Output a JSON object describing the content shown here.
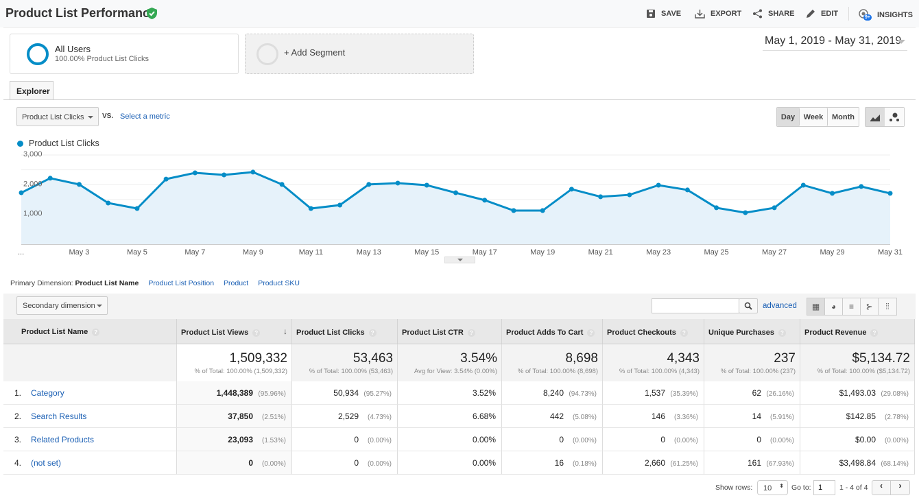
{
  "header": {
    "title": "Product List Performance",
    "actions": [
      {
        "label": "SAVE",
        "icon": "save-icon"
      },
      {
        "label": "EXPORT",
        "icon": "export-icon"
      },
      {
        "label": "SHARE",
        "icon": "share-icon"
      },
      {
        "label": "EDIT",
        "icon": "edit-icon"
      },
      {
        "label": "INSIGHTS",
        "icon": "insights-icon",
        "badge": "9+"
      }
    ]
  },
  "segments": {
    "active_name": "All Users",
    "active_sub": "100.00% Product List Clicks",
    "add_label": "+ Add Segment"
  },
  "date_range": "May 1, 2019 - May 31, 2019",
  "tab": "Explorer",
  "metric_select": "Product List Clicks",
  "vs": "VS.",
  "select_metric": "Select a metric",
  "granularity": {
    "options": [
      "Day",
      "Week",
      "Month"
    ],
    "selected": "Day"
  },
  "chart_data": {
    "type": "area",
    "legend": "Product List Clicks",
    "color": "#058dc7",
    "yticks": [
      "3,000",
      "2,000",
      "1,000"
    ],
    "ylim": [
      0,
      3000
    ],
    "grid": true,
    "xticks": [
      "...",
      "May 3",
      "May 5",
      "May 7",
      "May 9",
      "May 11",
      "May 13",
      "May 15",
      "May 17",
      "May 19",
      "May 21",
      "May 23",
      "May 25",
      "May 27",
      "May 29",
      "May 31"
    ],
    "x": [
      "May 1",
      "May 2",
      "May 3",
      "May 4",
      "May 5",
      "May 6",
      "May 7",
      "May 8",
      "May 9",
      "May 10",
      "May 11",
      "May 12",
      "May 13",
      "May 14",
      "May 15",
      "May 16",
      "May 17",
      "May 18",
      "May 19",
      "May 20",
      "May 21",
      "May 22",
      "May 23",
      "May 24",
      "May 25",
      "May 26",
      "May 27",
      "May 28",
      "May 29",
      "May 30",
      "May 31"
    ],
    "values": [
      1730,
      2220,
      2010,
      1385,
      1200,
      2190,
      2400,
      2330,
      2425,
      2010,
      1200,
      1315,
      2010,
      2055,
      1985,
      1730,
      1480,
      1130,
      1130,
      1850,
      1595,
      1660,
      1985,
      1825,
      1225,
      1060,
      1225,
      1985,
      1710,
      1940,
      1710
    ]
  },
  "primary_dimension": {
    "label": "Primary Dimension:",
    "selected": "Product List Name",
    "others": [
      "Product List Position",
      "Product",
      "Product SKU"
    ]
  },
  "secondary_dimension": "Secondary dimension",
  "advanced": "advanced",
  "table": {
    "columns": [
      "Product List Name",
      "Product List Views",
      "Product List Clicks",
      "Product List CTR",
      "Product Adds To Cart",
      "Product Checkouts",
      "Unique Purchases",
      "Product Revenue"
    ],
    "totals": [
      {
        "v": "1,509,332",
        "s": "% of Total: 100.00% (1,509,332)"
      },
      {
        "v": "53,463",
        "s": "% of Total: 100.00% (53,463)"
      },
      {
        "v": "3.54%",
        "s": "Avg for View: 3.54% (0.00%)"
      },
      {
        "v": "8,698",
        "s": "% of Total: 100.00% (8,698)"
      },
      {
        "v": "4,343",
        "s": "% of Total: 100.00% (4,343)"
      },
      {
        "v": "237",
        "s": "% of Total: 100.00% (237)"
      },
      {
        "v": "$5,134.72",
        "s": "% of Total: 100.00% ($5,134.72)"
      }
    ],
    "rows": [
      {
        "n": "1.",
        "name": "Category",
        "c": [
          [
            "1,448,389",
            "(95.96%)"
          ],
          [
            "50,934",
            "(95.27%)"
          ],
          [
            "3.52%",
            ""
          ],
          [
            "8,240",
            "(94.73%)"
          ],
          [
            "1,537",
            "(35.39%)"
          ],
          [
            "62",
            "(26.16%)"
          ],
          [
            "$1,493.03",
            "(29.08%)"
          ]
        ]
      },
      {
        "n": "2.",
        "name": "Search Results",
        "c": [
          [
            "37,850",
            "(2.51%)"
          ],
          [
            "2,529",
            "(4.73%)"
          ],
          [
            "6.68%",
            ""
          ],
          [
            "442",
            "(5.08%)"
          ],
          [
            "146",
            "(3.36%)"
          ],
          [
            "14",
            "(5.91%)"
          ],
          [
            "$142.85",
            "(2.78%)"
          ]
        ]
      },
      {
        "n": "3.",
        "name": "Related Products",
        "c": [
          [
            "23,093",
            "(1.53%)"
          ],
          [
            "0",
            "(0.00%)"
          ],
          [
            "0.00%",
            ""
          ],
          [
            "0",
            "(0.00%)"
          ],
          [
            "0",
            "(0.00%)"
          ],
          [
            "0",
            "(0.00%)"
          ],
          [
            "$0.00",
            "(0.00%)"
          ]
        ]
      },
      {
        "n": "4.",
        "name": "(not set)",
        "c": [
          [
            "0",
            "(0.00%)"
          ],
          [
            "0",
            "(0.00%)"
          ],
          [
            "0.00%",
            ""
          ],
          [
            "16",
            "(0.18%)"
          ],
          [
            "2,660",
            "(61.25%)"
          ],
          [
            "161",
            "(67.93%)"
          ],
          [
            "$3,498.84",
            "(68.14%)"
          ]
        ]
      }
    ]
  },
  "pagination": {
    "show_rows_label": "Show rows:",
    "rows": "10",
    "goto_label": "Go to:",
    "goto": "1",
    "range": "1 - 4 of 4"
  }
}
